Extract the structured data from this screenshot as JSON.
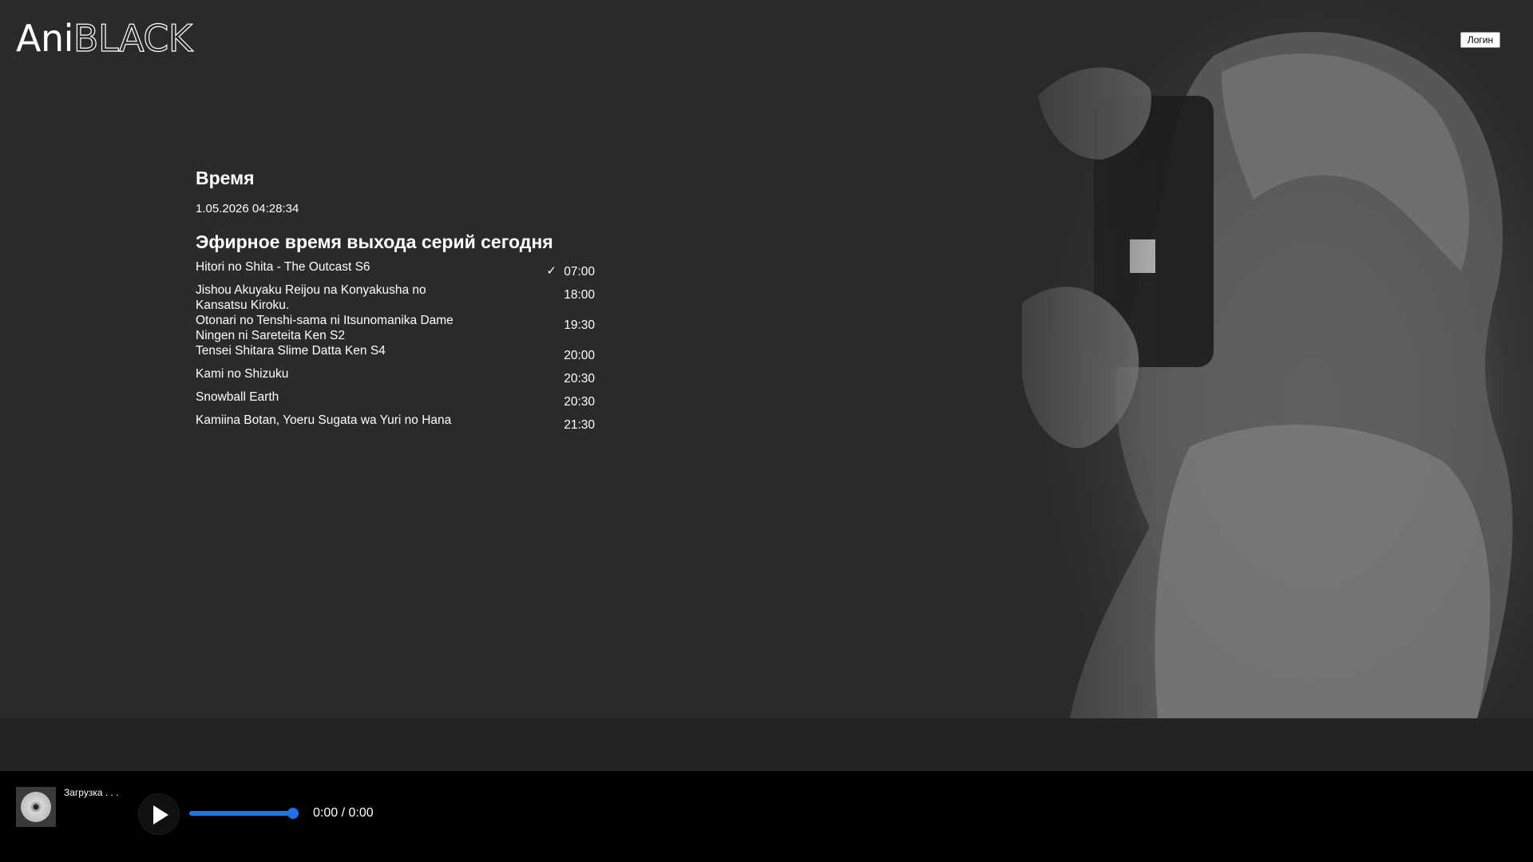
{
  "logo": {
    "part1": "Ani",
    "part2": "BLACK"
  },
  "header": {
    "login_label": "Логин"
  },
  "time_section": {
    "title": "Время",
    "datetime": "1.05.2026 04:28:34"
  },
  "schedule": {
    "title": "Эфирное время выхода серий сегодня",
    "items": [
      {
        "title": "Hitori no Shita - The Outcast S6",
        "time": "07:00",
        "checked": "✓"
      },
      {
        "title": "Jishou Akuyaku Reijou na Konyakusha no Kansatsu Kiroku.",
        "time": "18:00"
      },
      {
        "title": "Otonari no Tenshi-sama ni Itsunomanika Dame Ningen ni Sareteita Ken S2",
        "time": "19:30"
      },
      {
        "title": "Tensei Shitara Slime Datta Ken S4",
        "time": "20:00"
      },
      {
        "title": "Kami no Shizuku",
        "time": "20:30"
      },
      {
        "title": "Snowball Earth",
        "time": "20:30"
      },
      {
        "title": "Kamiina Botan, Yoeru Sugata wa Yuri no Hana",
        "time": "21:30"
      }
    ]
  },
  "player": {
    "status": "Загрузка . . .",
    "time_readout": "0:00 / 0:00",
    "progress": 1.0,
    "accent_color": "#1e73e8"
  }
}
